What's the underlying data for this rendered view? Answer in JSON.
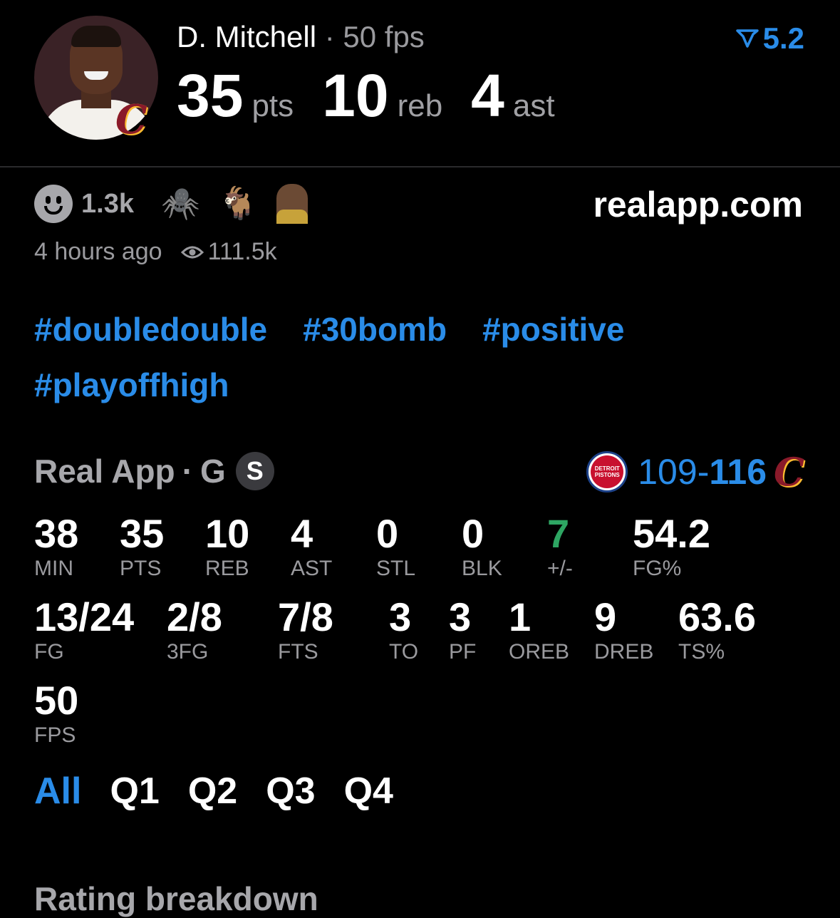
{
  "player": {
    "name": "D. Mitchell",
    "separator": "·",
    "fps_label": "50 fps",
    "rating": "5.2",
    "points": "35",
    "points_unit": "pts",
    "rebounds": "10",
    "rebounds_unit": "reb",
    "assists": "4",
    "assists_unit": "ast"
  },
  "reactions": {
    "count": "1.3k",
    "emojis": [
      "🕷️",
      "🐐"
    ],
    "site": "realapp.com"
  },
  "meta": {
    "time_ago": "4 hours ago",
    "views": "111.5k"
  },
  "tags": [
    "#doubledouble",
    "#30bomb",
    "#positive",
    "#playoffhigh"
  ],
  "game": {
    "source": "Real App",
    "separator": "·",
    "position": "G",
    "badge": "S",
    "away_logo_text": "DETROIT PISTONS",
    "away_score": "109",
    "dash": "-",
    "home_score": "116",
    "home_logo": "C"
  },
  "stats_row1": [
    {
      "value": "38",
      "label": "MIN"
    },
    {
      "value": "35",
      "label": "PTS"
    },
    {
      "value": "10",
      "label": "REB"
    },
    {
      "value": "4",
      "label": "AST"
    },
    {
      "value": "0",
      "label": "STL"
    },
    {
      "value": "0",
      "label": "BLK"
    },
    {
      "value": "7",
      "label": "+/-"
    },
    {
      "value": "54.2",
      "label": "FG%"
    }
  ],
  "stats_row2": [
    {
      "value": "13/24",
      "label": "FG"
    },
    {
      "value": "2/8",
      "label": "3FG"
    },
    {
      "value": "7/8",
      "label": "FTS"
    },
    {
      "value": "3",
      "label": "TO"
    },
    {
      "value": "3",
      "label": "PF"
    },
    {
      "value": "1",
      "label": "OREB"
    },
    {
      "value": "9",
      "label": "DREB"
    },
    {
      "value": "63.6",
      "label": "TS%"
    }
  ],
  "stats_row3": [
    {
      "value": "50",
      "label": "FPS"
    }
  ],
  "quarter_tabs": [
    "All",
    "Q1",
    "Q2",
    "Q3",
    "Q4"
  ],
  "section_title": "Rating breakdown",
  "colors": {
    "accent": "#2a8ce8",
    "positive": "#2ea663",
    "muted": "#9a9a9e"
  }
}
